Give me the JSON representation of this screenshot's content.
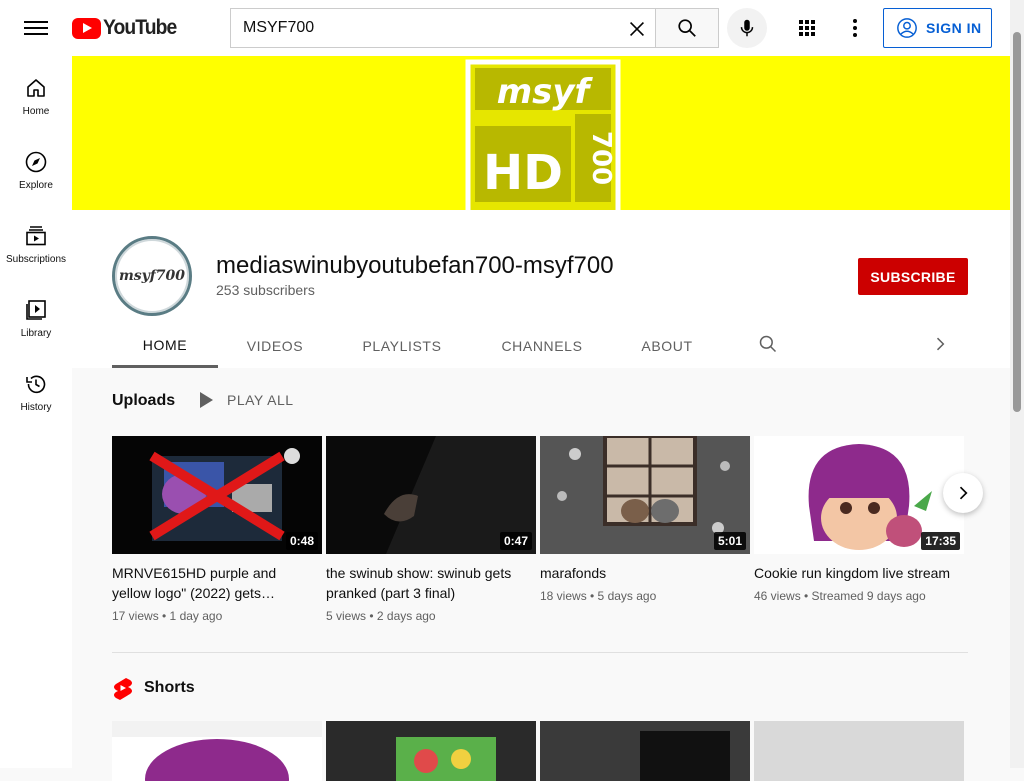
{
  "header": {
    "logo_text": "YouTube",
    "search_value": "MSYF700",
    "signin_label": "SIGN IN"
  },
  "sidebar": {
    "items": [
      {
        "label": "Home",
        "icon": "home-icon"
      },
      {
        "label": "Explore",
        "icon": "compass-icon"
      },
      {
        "label": "Subscriptions",
        "icon": "subscriptions-icon"
      },
      {
        "label": "Library",
        "icon": "library-icon"
      },
      {
        "label": "History",
        "icon": "history-icon"
      }
    ]
  },
  "banner": {
    "logo_top": "msyf",
    "logo_main": "HD",
    "logo_side": "700",
    "background": "#ffff00"
  },
  "channel": {
    "avatar_text": "msyf700",
    "name": "mediaswinubyoutubefan700-msyf700",
    "subscribers": "253 subscribers",
    "subscribe_label": "SUBSCRIBE"
  },
  "tabs": [
    {
      "label": "HOME",
      "active": true
    },
    {
      "label": "VIDEOS",
      "active": false
    },
    {
      "label": "PLAYLISTS",
      "active": false
    },
    {
      "label": "CHANNELS",
      "active": false
    },
    {
      "label": "ABOUT",
      "active": false
    }
  ],
  "uploads": {
    "title": "Uploads",
    "play_all": "PLAY ALL",
    "videos": [
      {
        "title": "MRNVE615HD purple and yellow logo\" (2022) gets…",
        "meta": "17 views • 1 day ago",
        "duration": "0:48"
      },
      {
        "title": "the swinub show: swinub gets pranked (part 3 final)",
        "meta": "5 views • 2 days ago",
        "duration": "0:47"
      },
      {
        "title": "marafonds",
        "meta": "18 views • 5 days ago",
        "duration": "5:01"
      },
      {
        "title": "Cookie run kingdom live stream",
        "meta": "46 views • Streamed 9 days ago",
        "duration": "17:35"
      }
    ]
  },
  "shorts": {
    "title": "Shorts"
  },
  "colors": {
    "brand_red": "#ff0000",
    "subscribe_red": "#cc0000",
    "link_blue": "#065fd4"
  }
}
